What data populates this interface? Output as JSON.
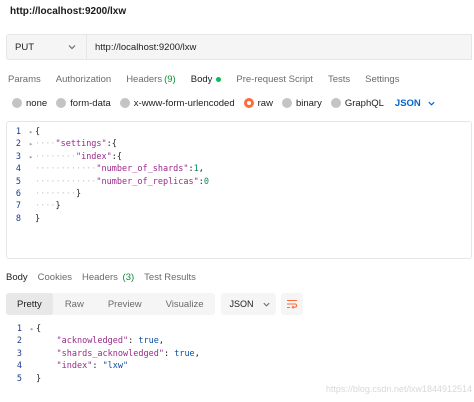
{
  "window": {
    "title": "http://localhost:9200/lxw"
  },
  "request": {
    "method": "PUT",
    "url": "http://localhost:9200/lxw"
  },
  "tabs": [
    {
      "label": "Params"
    },
    {
      "label": "Authorization"
    },
    {
      "label": "Headers",
      "count": "(9)"
    },
    {
      "label": "Body"
    },
    {
      "label": "Pre-request Script"
    },
    {
      "label": "Tests"
    },
    {
      "label": "Settings"
    }
  ],
  "body_types": [
    {
      "label": "none"
    },
    {
      "label": "form-data"
    },
    {
      "label": "x-www-form-urlencoded"
    },
    {
      "label": "raw",
      "selected": true
    },
    {
      "label": "binary"
    },
    {
      "label": "GraphQL"
    }
  ],
  "body_format": "JSON",
  "request_body": {
    "line_numbers": [
      "1",
      "2",
      "3",
      "4",
      "5",
      "6",
      "7",
      "8"
    ],
    "lines": [
      {
        "t": [
          {
            "c": "punc",
            "v": "{"
          }
        ]
      },
      {
        "t": [
          {
            "c": "guide",
            "v": "····"
          },
          {
            "c": "key",
            "v": "\"settings\""
          },
          {
            "c": "punc",
            "v": ":{"
          }
        ]
      },
      {
        "t": [
          {
            "c": "guide",
            "v": "········"
          },
          {
            "c": "key",
            "v": "\"index\""
          },
          {
            "c": "punc",
            "v": ":{"
          }
        ]
      },
      {
        "t": [
          {
            "c": "guide",
            "v": "············"
          },
          {
            "c": "key",
            "v": "\"number_of_shards\""
          },
          {
            "c": "punc",
            "v": ":"
          },
          {
            "c": "num",
            "v": "1"
          },
          {
            "c": "punc",
            "v": ","
          }
        ]
      },
      {
        "t": [
          {
            "c": "guide",
            "v": "············"
          },
          {
            "c": "key",
            "v": "\"number_of_replicas\""
          },
          {
            "c": "punc",
            "v": ":"
          },
          {
            "c": "num",
            "v": "0"
          }
        ]
      },
      {
        "t": [
          {
            "c": "guide",
            "v": "········"
          },
          {
            "c": "punc",
            "v": "}"
          }
        ]
      },
      {
        "t": [
          {
            "c": "guide",
            "v": "····"
          },
          {
            "c": "punc",
            "v": "}"
          }
        ]
      },
      {
        "t": [
          {
            "c": "punc",
            "v": "}"
          }
        ]
      }
    ]
  },
  "response_tabs": [
    {
      "label": "Body"
    },
    {
      "label": "Cookies"
    },
    {
      "label": "Headers",
      "count": "(3)"
    },
    {
      "label": "Test Results"
    }
  ],
  "response_view_modes": [
    "Pretty",
    "Raw",
    "Preview",
    "Visualize"
  ],
  "response_format": "JSON",
  "response_body": {
    "line_numbers": [
      "1",
      "2",
      "3",
      "4",
      "5"
    ],
    "lines": [
      {
        "t": [
          {
            "c": "punc",
            "v": "{"
          }
        ]
      },
      {
        "t": [
          {
            "c": "guide",
            "v": "    "
          },
          {
            "c": "key",
            "v": "\"acknowledged\""
          },
          {
            "c": "punc",
            "v": ": "
          },
          {
            "c": "str",
            "v": "true"
          },
          {
            "c": "punc",
            "v": ","
          }
        ]
      },
      {
        "t": [
          {
            "c": "guide",
            "v": "    "
          },
          {
            "c": "key",
            "v": "\"shards_acknowledged\""
          },
          {
            "c": "punc",
            "v": ": "
          },
          {
            "c": "str",
            "v": "true"
          },
          {
            "c": "punc",
            "v": ","
          }
        ]
      },
      {
        "t": [
          {
            "c": "guide",
            "v": "    "
          },
          {
            "c": "key",
            "v": "\"index\""
          },
          {
            "c": "punc",
            "v": ": "
          },
          {
            "c": "str",
            "v": "\"lxw\""
          }
        ]
      },
      {
        "t": [
          {
            "c": "punc",
            "v": "}"
          }
        ]
      }
    ]
  },
  "watermark": "https://blog.csdn.net/lxw1844912514",
  "colors": {
    "accent": "#ff6c37",
    "active_dot": "#0cbb52",
    "format_link": "#0265d2",
    "count": "#0f8a3b"
  }
}
